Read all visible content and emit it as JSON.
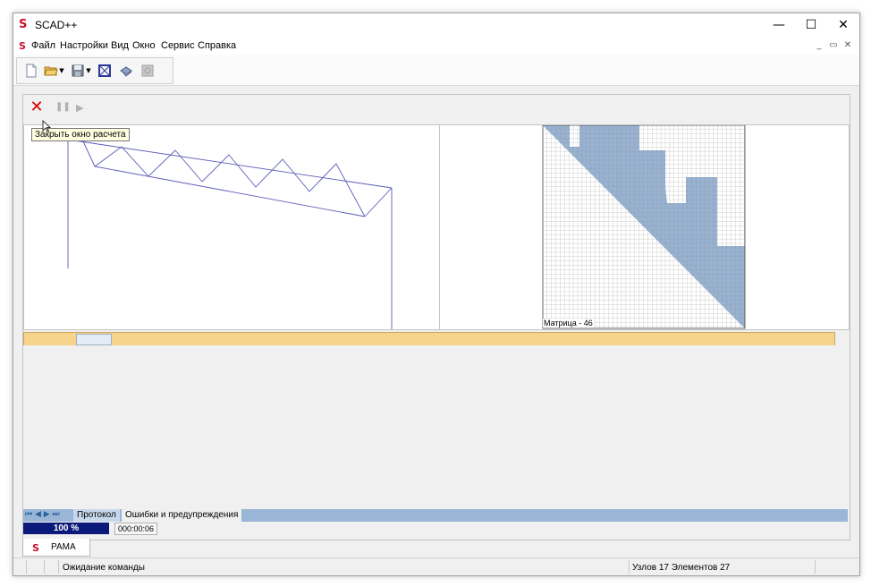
{
  "window": {
    "title": "SCAD++",
    "logo": "S",
    "controls": {
      "minimize": "—",
      "maximize": "☐",
      "close": "✕"
    }
  },
  "menu": {
    "items": [
      "Файл",
      "Настройки",
      "Вид",
      "Окно",
      "Сервис",
      "Справка"
    ],
    "mdi_controls": {
      "minimize": "_",
      "restore": "▭",
      "close": "✕"
    }
  },
  "toolbar": {
    "icons": [
      "new-file-icon",
      "open-folder-icon",
      "save-disk-icon",
      "frame-icon",
      "print-icon",
      "disabled-tool-icon"
    ]
  },
  "calc": {
    "close_glyph": "✕",
    "pause_glyph": "❚❚",
    "play_glyph": "▶",
    "tooltip": "Закрыть окно расчета"
  },
  "matrix": {
    "label": "Матрица - 46",
    "fill_color": "#98b2d2"
  },
  "progress": {
    "value": 0.05
  },
  "tabs": {
    "nav": "⏮ ◀ ▶ ⏭",
    "items": [
      "Протокол",
      "Ошибки и предупреждения"
    ]
  },
  "calc_status": {
    "percent": "100 %",
    "elapsed": "000:00:06"
  },
  "document_tab": {
    "label": "РАМА"
  },
  "statusbar": {
    "message": "Ожидание команды",
    "counts": "Узлов 17 Элементов 27"
  }
}
